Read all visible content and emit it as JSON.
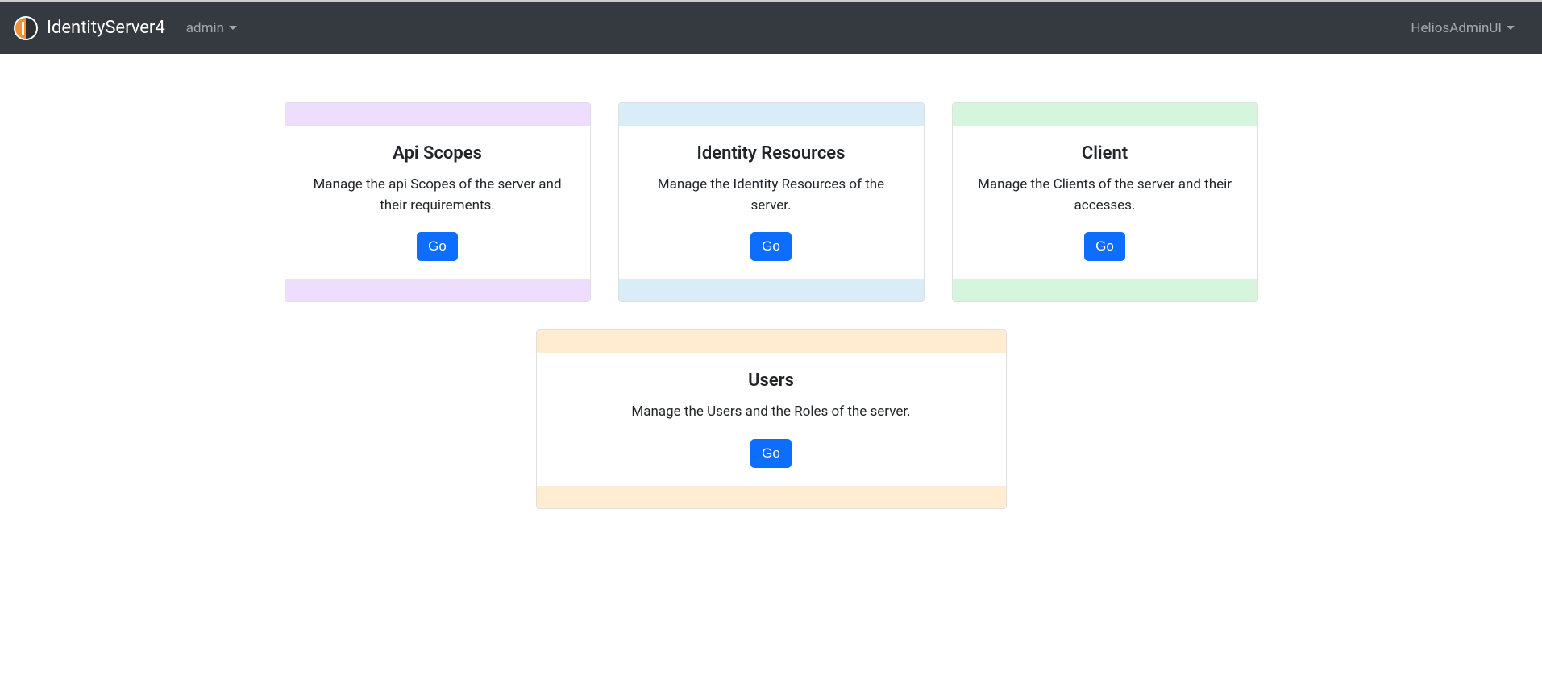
{
  "navbar": {
    "brand": "IdentityServer4",
    "left_link": "admin",
    "right_link": "HeliosAdminUI"
  },
  "cards": {
    "api_scopes": {
      "title": "Api Scopes",
      "text": "Manage the api Scopes of the server and their requirements.",
      "button": "Go",
      "color_class": "bg-purple"
    },
    "identity_resources": {
      "title": "Identity Resources",
      "text": "Manage the Identity Resources of the server.",
      "button": "Go",
      "color_class": "bg-blue"
    },
    "client": {
      "title": "Client",
      "text": "Manage the Clients of the server and their accesses.",
      "button": "Go",
      "color_class": "bg-green"
    },
    "users": {
      "title": "Users",
      "text": "Manage the Users and the Roles of the server.",
      "button": "Go",
      "color_class": "bg-orange"
    }
  }
}
